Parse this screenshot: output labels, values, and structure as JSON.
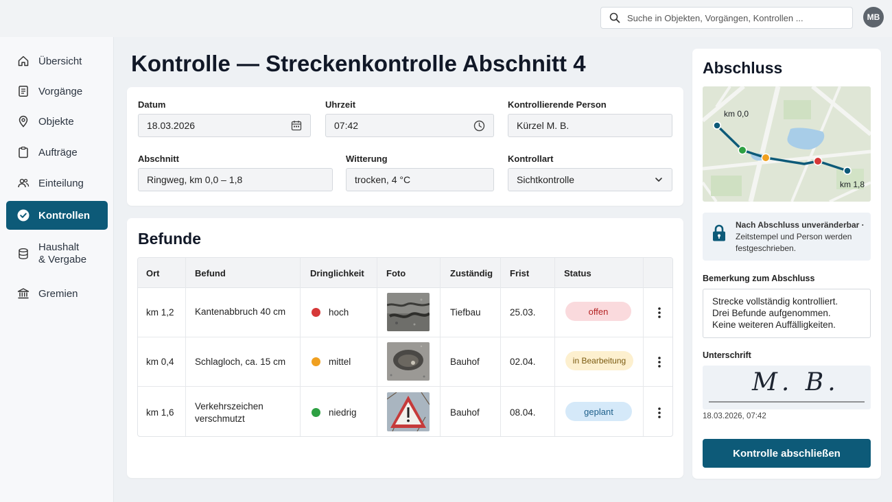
{
  "header": {
    "search_placeholder": "Suche in Objekten, Vorgängen, Kontrollen ...",
    "avatar_initials": "MB"
  },
  "sidebar": {
    "items": [
      {
        "label": "Übersicht",
        "icon": "home-icon"
      },
      {
        "label": "Vorgänge",
        "icon": "document-icon"
      },
      {
        "label": "Objekte",
        "icon": "location-pin-icon"
      },
      {
        "label": "Aufträge",
        "icon": "clipboard-icon"
      },
      {
        "label": "Einteilung",
        "icon": "users-icon"
      },
      {
        "label": "Kontrollen",
        "icon": "check-circle-icon",
        "active": true
      },
      {
        "label": "Haushalt",
        "label2": "& Vergabe",
        "icon": "database-icon"
      },
      {
        "label": "Gremien",
        "icon": "institution-icon"
      }
    ]
  },
  "page": {
    "title": "Kontrolle — Streckenkontrolle Abschnitt 4"
  },
  "form": {
    "datum": {
      "label": "Datum",
      "value": "18.03.2026"
    },
    "uhrzeit": {
      "label": "Uhrzeit",
      "value": "07:42"
    },
    "person": {
      "label": "Kontrollierende Person",
      "value": "Kürzel M. B."
    },
    "abschnitt": {
      "label": "Abschnitt",
      "value": "Ringweg, km 0,0 – 1,8"
    },
    "witterung": {
      "label": "Witterung",
      "value": "trocken, 4 °C"
    },
    "kontrollart": {
      "label": "Kontrollart",
      "value": "Sichtkontrolle"
    }
  },
  "befunde": {
    "title": "Befunde",
    "columns": [
      "Ort",
      "Befund",
      "Dringlichkeit",
      "Foto",
      "Zuständig",
      "Frist",
      "Status"
    ],
    "rows": [
      {
        "ort": "km 1,2",
        "befund": "Kantenabbruch 40 cm",
        "dringlichkeit": "hoch",
        "dot_color": "#d63838",
        "foto": "road-edge-damage-photo",
        "zustaendig": "Tiefbau",
        "frist": "25.03.",
        "status": "offen",
        "status_bg": "#fadadd",
        "status_fg": "#b42323"
      },
      {
        "ort": "km 0,4",
        "befund": "Schlagloch, ca. 15 cm",
        "dringlichkeit": "mittel",
        "dot_color": "#f0a020",
        "foto": "pothole-photo",
        "zustaendig": "Bauhof",
        "frist": "02.04.",
        "status": "in Bearbeitung",
        "status_bg": "#fdf0cf",
        "status_fg": "#7a5a10"
      },
      {
        "ort": "km 1,6",
        "befund": "Verkehrszeichen verschmutzt",
        "dringlichkeit": "niedrig",
        "dot_color": "#2ea043",
        "foto": "traffic-sign-photo",
        "zustaendig": "Bauhof",
        "frist": "08.04.",
        "status": "geplant",
        "status_bg": "#d5e9f9",
        "status_fg": "#1d5f8a"
      }
    ]
  },
  "abschluss": {
    "title": "Abschluss",
    "map": {
      "start_label": "km 0,0",
      "end_label": "km 1,8"
    },
    "notice_bold": "Nach Abschluss unveränderbar ·",
    "notice_rest": "Zeitstempel und Person werden festgeschrieben.",
    "remark_label": "Bemerkung zum Abschluss",
    "remark_text": "Strecke vollständig kontrolliert.\nDrei Befunde aufgenommen.\nKeine weiteren Auffälligkeiten.",
    "signature_label": "Unterschrift",
    "signature": "M. B.",
    "signature_timestamp": "18.03.2026, 07:42",
    "submit_label": "Kontrolle abschließen"
  },
  "colors": {
    "primary": "#0d5a78",
    "background": "#eef1f4"
  }
}
